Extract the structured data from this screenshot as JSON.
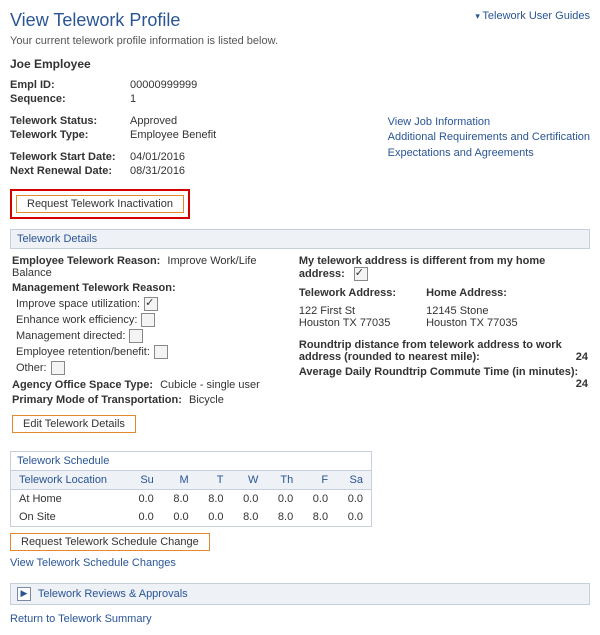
{
  "header": {
    "title": "View Telework Profile",
    "subtitle": "Your current telework profile information is listed below.",
    "user_guides": "Telework User Guides"
  },
  "employee": {
    "name": "Joe Employee",
    "empl_id_label": "Empl ID:",
    "empl_id": "00000999999",
    "sequence_label": "Sequence:",
    "sequence": "1"
  },
  "status": {
    "status_label": "Telework Status:",
    "status": "Approved",
    "type_label": "Telework Type:",
    "type": "Employee Benefit",
    "start_label": "Telework Start Date:",
    "start": "04/01/2016",
    "renewal_label": "Next Renewal Date:",
    "renewal": "08/31/2016"
  },
  "right_links": {
    "job": "View Job Information",
    "reqs": "Additional Requirements and Certification",
    "exp": "Expectations and Agreements"
  },
  "buttons": {
    "inactivate": "Request Telework Inactivation",
    "edit_details": "Edit Telework Details",
    "request_sched": "Request Telework Schedule Change"
  },
  "details": {
    "header": "Telework Details",
    "emp_reason_label": "Employee Telework Reason:",
    "emp_reason": "Improve Work/Life Balance",
    "mgmt_reason_label": "Management Telework Reason:",
    "chk": {
      "space": "Improve space utilization:",
      "efficiency": "Enhance work efficiency:",
      "directed": "Management directed:",
      "retention": "Employee retention/benefit:",
      "other": "Other:"
    },
    "office_type_label": "Agency Office Space Type:",
    "office_type": "Cubicle - single user",
    "transport_label": "Primary Mode of Transportation:",
    "transport": "Bicycle",
    "diff_addr_label": "My telework address is different from my home address:",
    "telework_addr_label": "Telework Address:",
    "telework_addr_l1": "122 First St",
    "telework_addr_l2": "Houston TX  77035",
    "home_addr_label": "Home Address:",
    "home_addr_l1": "12145 Stone",
    "home_addr_l2": "Houston TX  77035",
    "roundtrip_label": "Roundtrip distance from telework address to work address (rounded to nearest mile):",
    "roundtrip": "24",
    "commute_label": "Average Daily Roundtrip Commute Time (in minutes):",
    "commute": "24"
  },
  "schedule": {
    "header": "Telework Schedule",
    "location_col": "Telework Location",
    "days": [
      "Su",
      "M",
      "T",
      "W",
      "Th",
      "F",
      "Sa"
    ],
    "rows": [
      {
        "loc": "At Home",
        "vals": [
          "0.0",
          "8.0",
          "8.0",
          "0.0",
          "0.0",
          "0.0",
          "0.0"
        ]
      },
      {
        "loc": "On Site",
        "vals": [
          "0.0",
          "0.0",
          "0.0",
          "8.0",
          "8.0",
          "8.0",
          "0.0"
        ]
      }
    ],
    "view_changes": "View Telework Schedule Changes"
  },
  "reviews": {
    "header": "Telework Reviews & Approvals"
  },
  "footer": {
    "return": "Return to Telework Summary"
  }
}
